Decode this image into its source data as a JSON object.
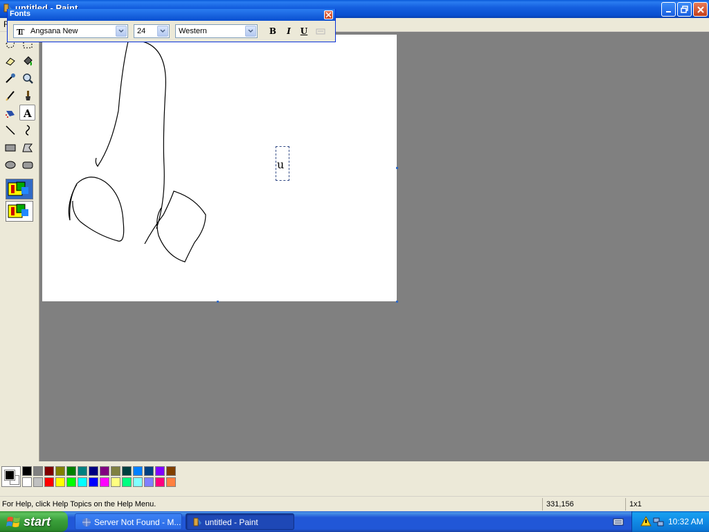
{
  "window": {
    "title": "untitled - Paint"
  },
  "menubar": {
    "visible_item": "F"
  },
  "fonts_toolbar": {
    "title": "Fonts",
    "font_name": "Angsana New",
    "font_size": "24",
    "script": "Western",
    "bold_label": "B",
    "italic_label": "I",
    "underline_label": "U"
  },
  "canvas": {
    "text_entry": "u"
  },
  "palette": {
    "foreground": "#000000",
    "background": "#ffffff",
    "colors": [
      "#000000",
      "#808080",
      "#800000",
      "#808000",
      "#008000",
      "#008080",
      "#000080",
      "#800080",
      "#808040",
      "#004040",
      "#0080ff",
      "#004080",
      "#8000ff",
      "#804000",
      "#ffffff",
      "#c0c0c0",
      "#ff0000",
      "#ffff00",
      "#00ff00",
      "#00ffff",
      "#0000ff",
      "#ff00ff",
      "#ffff80",
      "#00ff80",
      "#80ffff",
      "#8080ff",
      "#ff0080",
      "#ff8040"
    ]
  },
  "status": {
    "help": "For Help, click Help Topics on the Help Menu.",
    "coords": "331,156",
    "size": "1x1"
  },
  "taskbar": {
    "start": "start",
    "tasks": [
      {
        "label": "Server Not Found - M..."
      },
      {
        "label": "untitled - Paint"
      }
    ],
    "clock": "10:32 AM"
  }
}
